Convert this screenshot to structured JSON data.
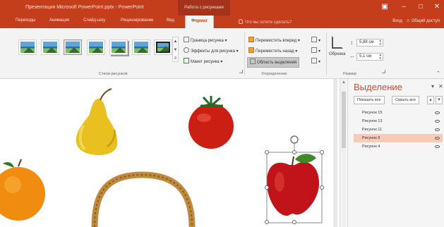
{
  "titlebar": {
    "document_title": "Презентация Microsoft PowerPoint.pptx - PowerPoint",
    "context_tab_title": "Работа с рисунками",
    "window_controls": [
      "restore-ribbon-icon",
      "minimize-icon",
      "maximize-icon",
      "close-icon"
    ]
  },
  "tabs": {
    "items": [
      "Переходы",
      "Анимация",
      "Слайд-шоу",
      "Рецензирование",
      "Вид"
    ],
    "active": "Формат",
    "tell_me": "Что вы хотите сделать?",
    "sign_in": "Вход",
    "share": "Общий доступ"
  },
  "ribbon": {
    "picture_styles": {
      "label": "Стили рисунков",
      "commands": [
        "Граница рисунка",
        "Эффекты для рисунка",
        "Макет рисунка"
      ]
    },
    "arrange": {
      "label": "Упорядочение",
      "commands": [
        "Переместить вперед",
        "Переместить назад",
        "Область выделения"
      ]
    },
    "size": {
      "label": "Размер",
      "crop": "Обрезка",
      "height": "5,88 см",
      "width": "5,1 см"
    }
  },
  "selection_pane": {
    "title": "Выделение",
    "show_all": "Показать все",
    "hide_all": "Скрыть все",
    "items": [
      "Рисунок 15",
      "Рисунок 13",
      "Рисунок 11",
      "Рисунок 9",
      "Рисунок 4"
    ],
    "selected": "Рисунок 9"
  },
  "colors": {
    "accent": "#c43e1c",
    "pane_title": "#d04a2b",
    "selected_row": "#f8cbb8"
  }
}
